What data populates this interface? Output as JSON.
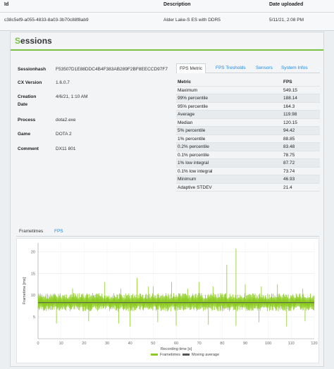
{
  "header": {
    "col_id": "Id",
    "col_description": "Description",
    "col_date": "Date uploaded",
    "row_id": "c38c5ef9-a055-4833-8a03-3b70c88f8ab9",
    "row_description": "Alder Lake-S ES with DDR5",
    "row_date": "5/11/21, 2:08 PM"
  },
  "sessions": {
    "title_first": "S",
    "title_rest": "essions"
  },
  "info": {
    "sessionhash_label": "Sessionhash",
    "sessionhash_value": "F53507D1E88DDC4B4F383AB289F2BF8EECCD97F7",
    "cxversion_label": "CX Version",
    "cxversion_value": "1.6.0.7",
    "creation_label": "Creation Date",
    "creation_label_1": "Creation",
    "creation_label_2": "Date",
    "creation_value": "4/6/21, 1:10 AM",
    "process_label": "Process",
    "process_value": "dota2.exe",
    "game_label": "Game",
    "game_value": "DOTA 2",
    "comment_label": "Comment",
    "comment_value": "DX11 801"
  },
  "tabs": [
    {
      "label": "FPS Metric"
    },
    {
      "label": "FPS Tresholds"
    },
    {
      "label": "Sensors"
    },
    {
      "label": "System Infos"
    }
  ],
  "metrics": {
    "head_name": "Metric",
    "head_value": "FPS",
    "rows": [
      {
        "name": "Maximum",
        "value": "549.15"
      },
      {
        "name": "99% percentile",
        "value": "188.14"
      },
      {
        "name": "95% percentile",
        "value": "164.3"
      },
      {
        "name": "Average",
        "value": "119.98"
      },
      {
        "name": "Median",
        "value": "120.15"
      },
      {
        "name": "5% percentile",
        "value": "94.42"
      },
      {
        "name": "1% percentile",
        "value": "88.85"
      },
      {
        "name": "0.2% percentile",
        "value": "83.48"
      },
      {
        "name": "0.1% percentile",
        "value": "78.75"
      },
      {
        "name": "1% low integral",
        "value": "87.72"
      },
      {
        "name": "0.1% low integral",
        "value": "73.74"
      },
      {
        "name": "Minimum",
        "value": "46.93"
      },
      {
        "name": "Adaptive STDEV",
        "value": "21.4"
      }
    ]
  },
  "chart_tabs": {
    "frametimes": "Frametimes",
    "fps": "FPS"
  },
  "chart_data": {
    "type": "line",
    "xlabel": "Recording time [s]",
    "ylabel": "Frametime [ms]",
    "xlim": [
      0,
      120
    ],
    "ylim": [
      0,
      22
    ],
    "xticks": [
      0,
      10,
      20,
      30,
      40,
      50,
      60,
      70,
      80,
      90,
      100,
      110,
      120
    ],
    "yticks": [
      5,
      10,
      15,
      20
    ],
    "series": [
      {
        "name": "Frametimes",
        "color": "#8ccc1e",
        "band_low": 6.3,
        "band_high": 10.5,
        "center": 8.3
      },
      {
        "name": "Moving average",
        "color": "#555555",
        "values": [
          8.3,
          8.3
        ]
      }
    ],
    "spikes": [
      {
        "x": 15,
        "y": 11.5
      },
      {
        "x": 29,
        "y": 13.0
      },
      {
        "x": 36,
        "y": 11.5
      },
      {
        "x": 43,
        "y": 14.0
      },
      {
        "x": 48,
        "y": 12.0
      },
      {
        "x": 50,
        "y": 12.0
      },
      {
        "x": 58,
        "y": 13.0
      },
      {
        "x": 65,
        "y": 11.5
      },
      {
        "x": 70,
        "y": 13.0
      },
      {
        "x": 76,
        "y": 12.0
      },
      {
        "x": 82,
        "y": 17.0
      },
      {
        "x": 86,
        "y": 20.7
      },
      {
        "x": 90,
        "y": 12.5
      },
      {
        "x": 97,
        "y": 12.0
      },
      {
        "x": 104,
        "y": 12.5
      },
      {
        "x": 115,
        "y": 11.5
      }
    ],
    "dips": [
      {
        "x": 8,
        "y": 3.5
      },
      {
        "x": 22,
        "y": 4.0
      },
      {
        "x": 35,
        "y": 3.5
      },
      {
        "x": 40,
        "y": 2.8
      },
      {
        "x": 52,
        "y": 3.8
      },
      {
        "x": 60,
        "y": 3.0
      },
      {
        "x": 74,
        "y": 3.2
      },
      {
        "x": 86,
        "y": 3.0
      },
      {
        "x": 96,
        "y": 3.8
      },
      {
        "x": 108,
        "y": 2.8
      },
      {
        "x": 116,
        "y": 4.0
      }
    ],
    "legend_position": "bottom-center"
  }
}
